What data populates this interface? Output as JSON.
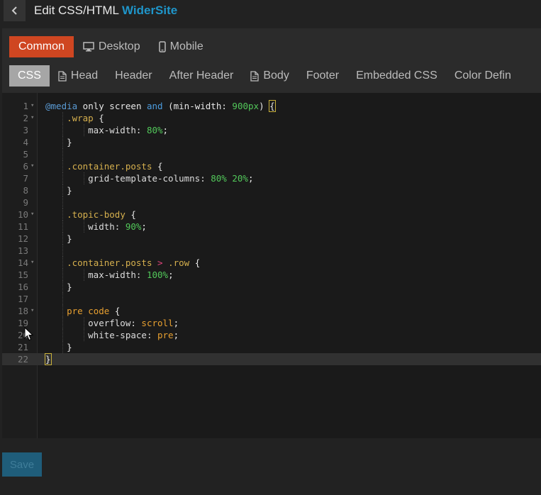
{
  "header": {
    "title": "Edit CSS/HTML",
    "site_name": "WiderSite"
  },
  "targets": [
    {
      "label": "Common",
      "icon": "none",
      "active": true
    },
    {
      "label": "Desktop",
      "icon": "desktop-icon",
      "active": false
    },
    {
      "label": "Mobile",
      "icon": "mobile-icon",
      "active": false
    }
  ],
  "tabs": [
    {
      "label": "CSS",
      "icon": "none",
      "active": true
    },
    {
      "label": "Head",
      "icon": "file-icon",
      "active": false
    },
    {
      "label": "Header",
      "icon": "none",
      "active": false
    },
    {
      "label": "After Header",
      "icon": "none",
      "active": false
    },
    {
      "label": "Body",
      "icon": "file-icon",
      "active": false
    },
    {
      "label": "Footer",
      "icon": "none",
      "active": false
    },
    {
      "label": "Embedded CSS",
      "icon": "none",
      "active": false
    },
    {
      "label": "Color Defin",
      "icon": "none",
      "active": false
    }
  ],
  "editor": {
    "current_line": 22,
    "lines": [
      {
        "n": "1",
        "fold": true,
        "indent": 0,
        "tokens": [
          [
            "at",
            "@media"
          ],
          [
            "kw",
            " only screen "
          ],
          [
            "blue",
            "and"
          ],
          [
            "kw",
            " (min-width: "
          ],
          [
            "num",
            "900px"
          ],
          [
            "kw",
            ") "
          ],
          [
            "hl",
            "{"
          ]
        ]
      },
      {
        "n": "2",
        "fold": true,
        "indent": 1,
        "tokens": [
          [
            "sel",
            ".wrap"
          ],
          [
            "kw",
            " {"
          ]
        ]
      },
      {
        "n": "3",
        "fold": false,
        "indent": 2,
        "tokens": [
          [
            "prop",
            "max-width: "
          ],
          [
            "num",
            "80%"
          ],
          [
            "kw",
            ";"
          ]
        ]
      },
      {
        "n": "4",
        "fold": false,
        "indent": 1,
        "tokens": [
          [
            "kw",
            "}"
          ]
        ]
      },
      {
        "n": "5",
        "fold": false,
        "indent": 0,
        "tokens": []
      },
      {
        "n": "6",
        "fold": true,
        "indent": 1,
        "tokens": [
          [
            "sel",
            ".container.posts"
          ],
          [
            "kw",
            " {"
          ]
        ]
      },
      {
        "n": "7",
        "fold": false,
        "indent": 2,
        "tokens": [
          [
            "prop",
            "grid-template-columns: "
          ],
          [
            "num",
            "80% 20%"
          ],
          [
            "kw",
            ";"
          ]
        ]
      },
      {
        "n": "8",
        "fold": false,
        "indent": 1,
        "tokens": [
          [
            "kw",
            "}"
          ]
        ]
      },
      {
        "n": "9",
        "fold": false,
        "indent": 0,
        "tokens": []
      },
      {
        "n": "10",
        "fold": true,
        "indent": 1,
        "tokens": [
          [
            "sel",
            ".topic-body"
          ],
          [
            "kw",
            " {"
          ]
        ]
      },
      {
        "n": "11",
        "fold": false,
        "indent": 2,
        "tokens": [
          [
            "prop",
            "width: "
          ],
          [
            "num",
            "90%"
          ],
          [
            "kw",
            ";"
          ]
        ]
      },
      {
        "n": "12",
        "fold": false,
        "indent": 1,
        "tokens": [
          [
            "kw",
            "}"
          ]
        ]
      },
      {
        "n": "13",
        "fold": false,
        "indent": 0,
        "tokens": []
      },
      {
        "n": "14",
        "fold": true,
        "indent": 1,
        "tokens": [
          [
            "sel",
            ".container.posts"
          ],
          [
            "gt",
            " > "
          ],
          [
            "sel",
            ".row"
          ],
          [
            "kw",
            " {"
          ]
        ]
      },
      {
        "n": "15",
        "fold": false,
        "indent": 2,
        "tokens": [
          [
            "prop",
            "max-width: "
          ],
          [
            "num",
            "100%"
          ],
          [
            "kw",
            ";"
          ]
        ]
      },
      {
        "n": "16",
        "fold": false,
        "indent": 1,
        "tokens": [
          [
            "kw",
            "}"
          ]
        ]
      },
      {
        "n": "17",
        "fold": false,
        "indent": 0,
        "tokens": []
      },
      {
        "n": "18",
        "fold": true,
        "indent": 1,
        "tokens": [
          [
            "tag",
            "pre"
          ],
          [
            "kw",
            " "
          ],
          [
            "tag",
            "code"
          ],
          [
            "kw",
            " {"
          ]
        ]
      },
      {
        "n": "19",
        "fold": false,
        "indent": 2,
        "tokens": [
          [
            "prop",
            "overflow: "
          ],
          [
            "val",
            "scroll"
          ],
          [
            "kw",
            ";"
          ]
        ]
      },
      {
        "n": "20",
        "fold": false,
        "indent": 2,
        "tokens": [
          [
            "prop",
            "white-space: "
          ],
          [
            "val",
            "pre"
          ],
          [
            "kw",
            ";"
          ]
        ]
      },
      {
        "n": "21",
        "fold": false,
        "indent": 1,
        "tokens": [
          [
            "kw",
            "}"
          ]
        ]
      },
      {
        "n": "22",
        "fold": false,
        "indent": 0,
        "tokens": [
          [
            "hl",
            "}"
          ]
        ]
      }
    ]
  },
  "footer": {
    "save_label": "Save"
  },
  "colors": {
    "accent_active": "#cf4621",
    "site_name": "#1f95c9",
    "save_bg": "#1f5d7a"
  }
}
